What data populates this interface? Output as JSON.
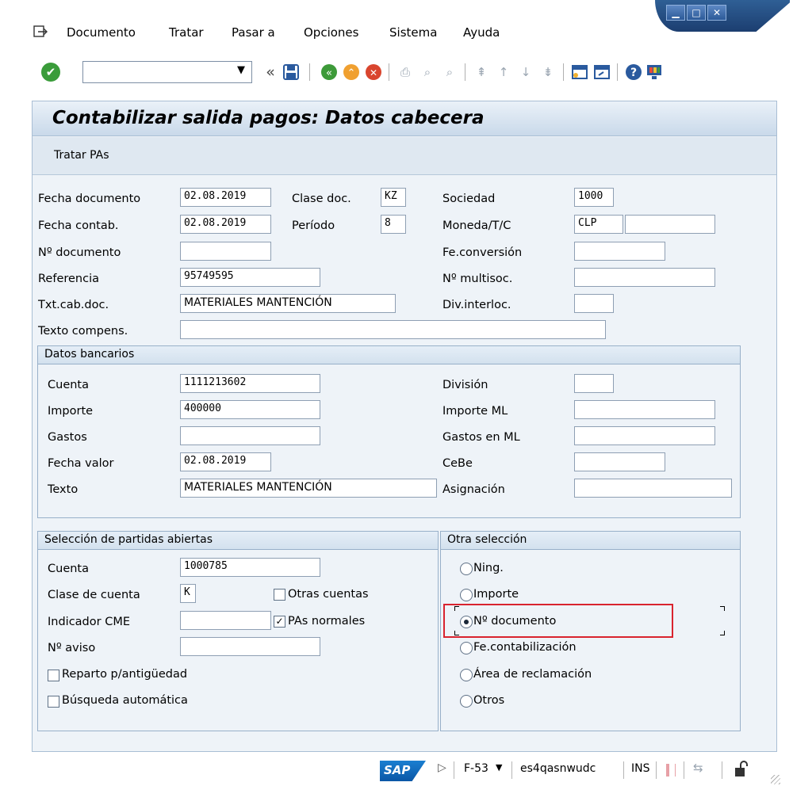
{
  "window": {
    "controls": [
      "minimize",
      "maximize",
      "close"
    ]
  },
  "menu": {
    "icon": "exit-menu-icon",
    "items": [
      "Documento",
      "Tratar",
      "Pasar a",
      "Opciones",
      "Sistema",
      "Ayuda"
    ]
  },
  "toolbar": {
    "command_field_value": "",
    "icons": [
      "enter",
      "dropdown",
      "history-back",
      "save",
      "back",
      "exit",
      "cancel",
      "print",
      "find",
      "find-next",
      "first-page",
      "previous-page",
      "next-page",
      "last-page",
      "create-session",
      "shortcut",
      "help",
      "customize-layout"
    ]
  },
  "page": {
    "title": "Contabilizar salida pagos: Datos cabecera",
    "app_toolbar_button": "Tratar PAs"
  },
  "header": {
    "fecha_documento": {
      "label": "Fecha documento",
      "value": "02.08.2019"
    },
    "clase_doc": {
      "label": "Clase doc.",
      "value": "KZ"
    },
    "sociedad": {
      "label": "Sociedad",
      "value": "1000"
    },
    "fecha_contab": {
      "label": "Fecha contab.",
      "value": "02.08.2019"
    },
    "periodo": {
      "label": "Período",
      "value": "8"
    },
    "moneda": {
      "label": "Moneda/T/C",
      "value": "CLP",
      "rate": ""
    },
    "n_documento": {
      "label": "Nº documento",
      "value": ""
    },
    "fe_conversion": {
      "label": "Fe.conversión",
      "value": ""
    },
    "referencia": {
      "label": "Referencia",
      "value": "95749595"
    },
    "n_multisoc": {
      "label": "Nº multisoc.",
      "value": ""
    },
    "txt_cab_doc": {
      "label": "Txt.cab.doc.",
      "value": "MATERIALES MANTENCIÓN"
    },
    "div_interloc": {
      "label": "Div.interloc.",
      "value": ""
    },
    "texto_compens": {
      "label": "Texto compens.",
      "value": ""
    }
  },
  "bank": {
    "title": "Datos bancarios",
    "cuenta": {
      "label": "Cuenta",
      "value": "1111213602"
    },
    "division": {
      "label": "División",
      "value": ""
    },
    "importe": {
      "label": "Importe",
      "value": "400000"
    },
    "importe_ml": {
      "label": "Importe ML",
      "value": ""
    },
    "gastos": {
      "label": "Gastos",
      "value": ""
    },
    "gastos_ml": {
      "label": "Gastos en ML",
      "value": ""
    },
    "fecha_valor": {
      "label": "Fecha valor",
      "value": "02.08.2019"
    },
    "cebe": {
      "label": "CeBe",
      "value": ""
    },
    "texto": {
      "label": "Texto",
      "value": "MATERIALES MANTENCIÓN"
    },
    "asignacion": {
      "label": "Asignación",
      "value": ""
    }
  },
  "open_items": {
    "title": "Selección de partidas abiertas",
    "cuenta": {
      "label": "Cuenta",
      "value": "1000785"
    },
    "clase_cuenta": {
      "label": "Clase de cuenta",
      "value": "K"
    },
    "otras_cuentas": {
      "label": "Otras cuentas",
      "checked": false
    },
    "indicador_cme": {
      "label": "Indicador CME",
      "value": ""
    },
    "pas_normales": {
      "label": "PAs normales",
      "checked": true
    },
    "n_aviso": {
      "label": "Nº aviso",
      "value": ""
    },
    "reparto": {
      "label": "Reparto p/antigüedad",
      "checked": false
    },
    "busqueda": {
      "label": "Búsqueda automática",
      "checked": false
    }
  },
  "other_selection": {
    "title": "Otra selección",
    "options": [
      "Ning.",
      "Importe",
      "Nº documento",
      "Fe.contabilización",
      "Área de reclamación",
      "Otros"
    ],
    "selected": "Nº documento",
    "highlight_color": "#d9232e"
  },
  "status": {
    "logo": "SAP",
    "transaction": "F-53",
    "server": "es4qasnwudc",
    "mode": "INS"
  }
}
